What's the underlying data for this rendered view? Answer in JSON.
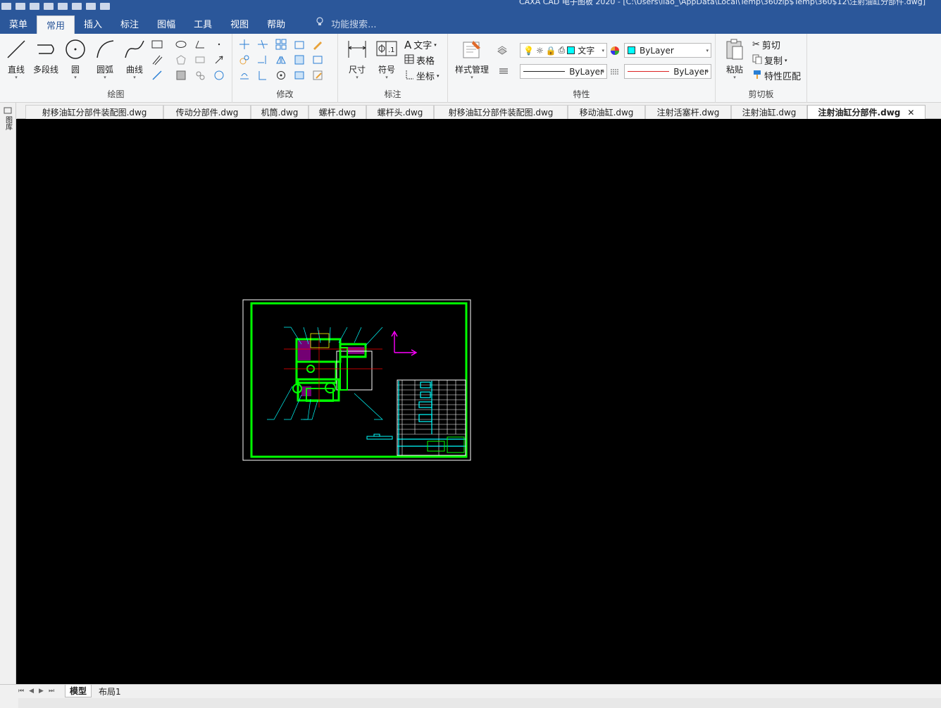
{
  "window": {
    "title": "CAXA CAD 电子图板 2020 - [C:\\Users\\liao_\\AppData\\Local\\Temp\\360zip$Temp\\360$12\\注射油缸分部件.dwg]"
  },
  "menu": {
    "items": [
      "菜单",
      "常用",
      "插入",
      "标注",
      "图幅",
      "工具",
      "视图",
      "帮助"
    ],
    "active": "常用",
    "search_placeholder": "功能搜索..."
  },
  "ribbon": {
    "draw": {
      "label": "绘图",
      "buttons": [
        "直线",
        "多段线",
        "圆",
        "圆弧",
        "曲线"
      ]
    },
    "modify": {
      "label": "修改"
    },
    "annotate": {
      "label": "标注",
      "buttons": [
        "尺寸",
        "符号"
      ],
      "text_buttons": [
        "文字",
        "表格",
        "坐标"
      ]
    },
    "properties": {
      "label": "特性",
      "style_button": "样式管理",
      "layer_value": "文字",
      "color_value": "ByLayer",
      "linetype_value": "ByLayer",
      "lineweight_value": "ByLayer"
    },
    "clipboard": {
      "label": "剪切板",
      "paste": "粘贴",
      "cut": "剪切",
      "copy": "复制",
      "match": "特性匹配"
    }
  },
  "document_tabs": [
    "射移油缸分部件装配图.dwg",
    "传动分部件.dwg",
    "机筒.dwg",
    "螺杆.dwg",
    "螺杆头.dwg",
    "射移油缸分部件装配图.dwg",
    "移动油缸.dwg",
    "注射活塞杆.dwg",
    "注射油缸.dwg",
    "注射油缸分部件.dwg"
  ],
  "active_tab": "注射油缸分部件.dwg",
  "left_panel_label": "图库",
  "layout_tabs": [
    "模型",
    "布局1"
  ],
  "active_layout": "模型",
  "colors": {
    "title_bar": "#2b579a",
    "canvas": "#000000",
    "drawing_frame": "#00ff00",
    "cyan_annotation": "#00ffff",
    "magenta_ucs": "#ff00ff"
  }
}
